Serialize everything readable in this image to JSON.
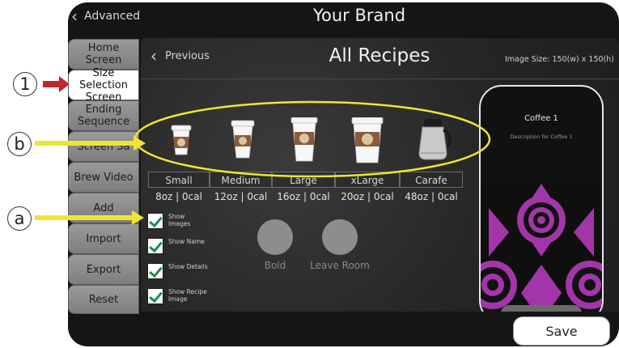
{
  "header": {
    "back_label": "Advanced",
    "brand_title": "Your Brand"
  },
  "sidebar": {
    "items": [
      {
        "label": "Home Screen"
      },
      {
        "label": "Size Selection Screen",
        "active": true
      },
      {
        "label": "Ending Sequence"
      },
      {
        "label": "Screen Sa"
      },
      {
        "label": "Brew Video"
      },
      {
        "label": "Add"
      },
      {
        "label": "Import"
      },
      {
        "label": "Export"
      },
      {
        "label": "Reset"
      }
    ]
  },
  "panel": {
    "prev_label": "Previous",
    "title": "All Recipes",
    "image_size": "Image Size: 150(w) x 150(h)"
  },
  "sizes": [
    {
      "name": "Small",
      "info": "8oz | 0cal",
      "icon": "small-cup-icon"
    },
    {
      "name": "Medium",
      "info": "12oz | 0cal",
      "icon": "medium-cup-icon"
    },
    {
      "name": "Large",
      "info": "16oz | 0cal",
      "icon": "large-cup-icon"
    },
    {
      "name": "xLarge",
      "info": "20oz | 0cal",
      "icon": "xlarge-cup-icon"
    },
    {
      "name": "Carafe",
      "info": "48oz | 0cal",
      "icon": "carafe-icon"
    }
  ],
  "options": [
    {
      "label": "Show Images",
      "checked": true
    },
    {
      "label": "Show Name",
      "checked": true
    },
    {
      "label": "Show Details",
      "checked": true
    },
    {
      "label": "Show Recipe Image",
      "checked": true
    }
  ],
  "styles": [
    {
      "label": "Bold"
    },
    {
      "label": "Leave Room"
    }
  ],
  "preview": {
    "name": "Coffee 1",
    "description": "Description for Coffee 1"
  },
  "save_label": "Save",
  "callouts": {
    "one": "1",
    "b": "b",
    "a": "a"
  },
  "colors": {
    "highlight_ellipse": "#f2e531",
    "arrow_yellow": "#f2e531",
    "arrow_red": "#c0262d",
    "check_green": "#1f8a4c",
    "pattern_purple": "#a236a8"
  }
}
